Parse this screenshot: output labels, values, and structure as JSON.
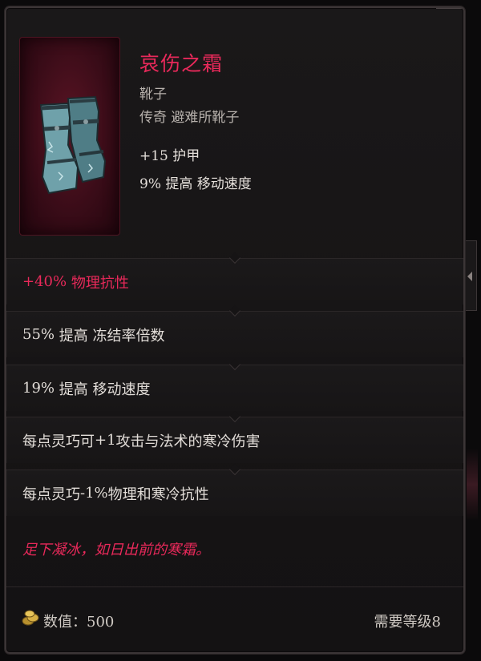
{
  "item": {
    "name": "哀伤之霜",
    "type": "靴子",
    "rarity_line": "传奇 避难所靴子",
    "base_stats": [
      {
        "value": "+15",
        "text": "护甲"
      },
      {
        "value": "9%",
        "text": "提高 移动速度"
      }
    ]
  },
  "properties": [
    {
      "value": "+40%",
      "text": "物理抗性"
    },
    {
      "value": "55%",
      "text": "提高 冻结率倍数"
    },
    {
      "value": "19%",
      "text": "提高 移动速度"
    },
    {
      "prefix": "每点灵巧可",
      "value": "+1",
      "text": "攻击与法术的寒冷伤害"
    },
    {
      "prefix": "每点灵巧",
      "value": "-1%",
      "text": "物理和寒冷抗性"
    }
  ],
  "flavor_text": "足下凝冰，如日出前的寒霜。",
  "footer": {
    "value_label": "数值：",
    "value": "500",
    "level_label": "需要等级",
    "level": "8"
  },
  "colors": {
    "legendary_accent": "#e8295a",
    "text": "#e2ddd8",
    "muted": "#b8b2ad"
  },
  "icons": {
    "item_icon": "frost-boots-icon",
    "currency_icon": "gold-coins-icon"
  }
}
